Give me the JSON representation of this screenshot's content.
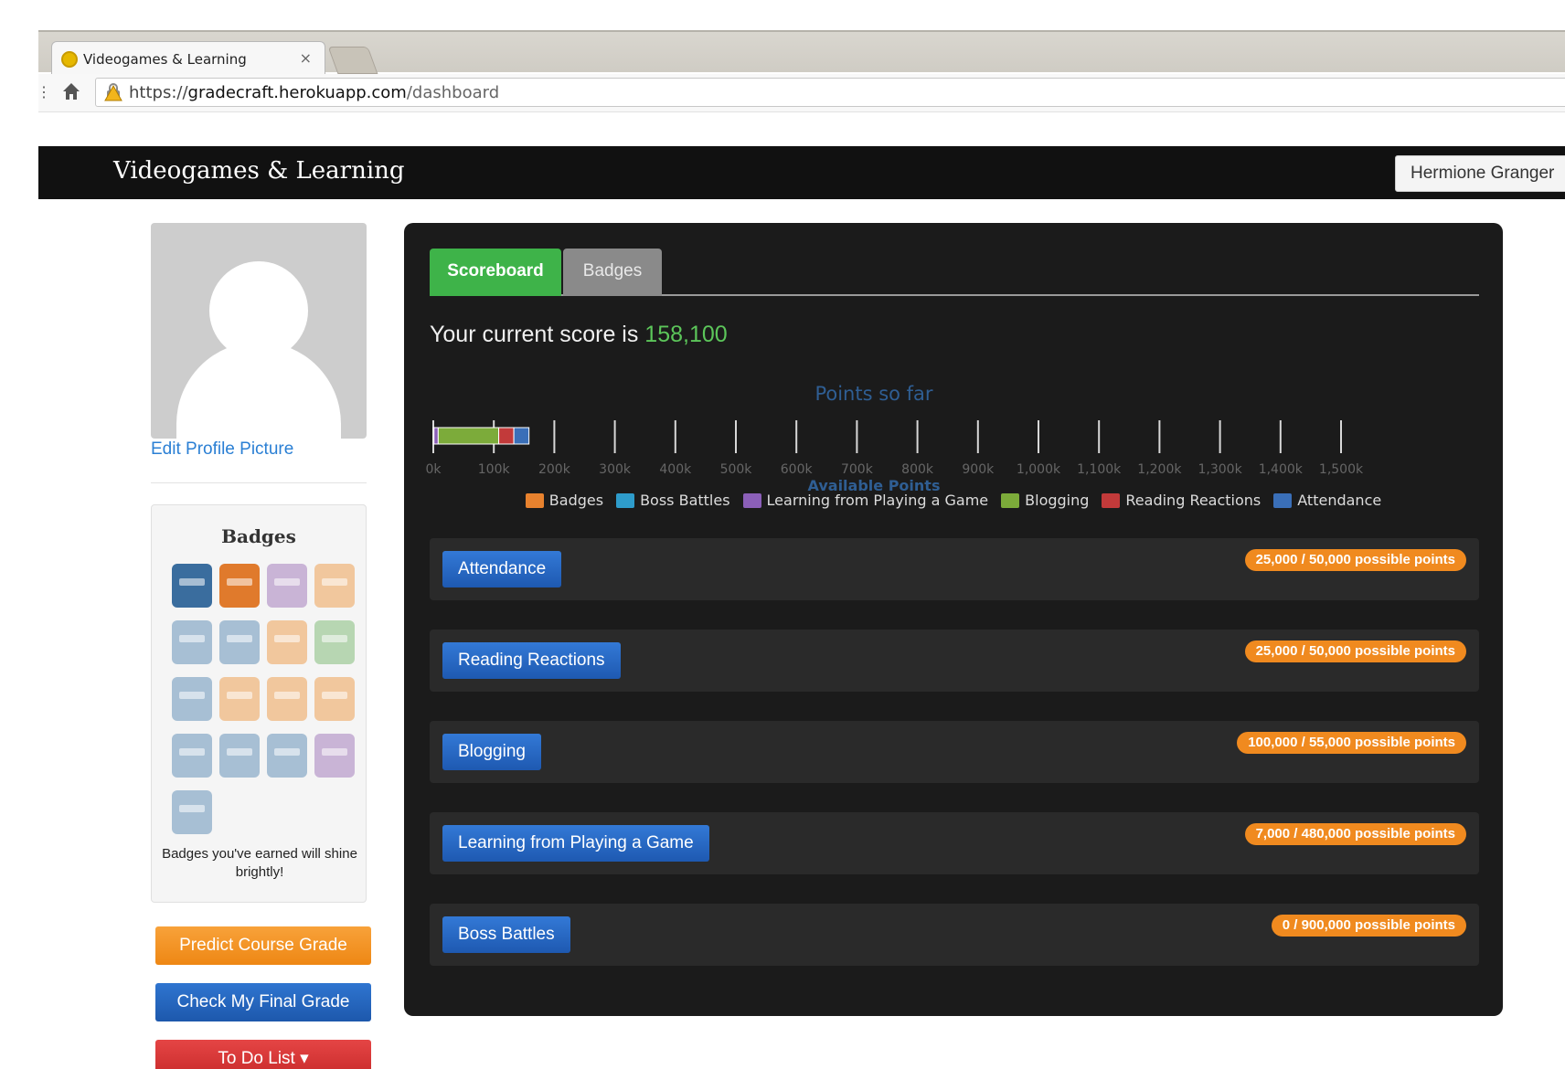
{
  "browser": {
    "tab_title": "Videogames & Learning",
    "tab_close": "×",
    "menu_glyph": "⋮",
    "url_scheme": "https://",
    "url_host": "gradecraft.herokuapp.com",
    "url_path": "/dashboard"
  },
  "navbar": {
    "brand": "Videogames & Learning",
    "user": "Hermione Granger"
  },
  "sidebar": {
    "edit_profile": "Edit Profile Picture",
    "badges_title": "Badges",
    "badges_note": "Badges you've earned will shine brightly!",
    "badges": [
      {
        "icon": "robot-badge-icon",
        "earned": true,
        "tone": "blue"
      },
      {
        "icon": "pirate-badge-icon",
        "earned": true,
        "tone": "orange"
      },
      {
        "icon": "castle-badge-icon",
        "earned": false,
        "tone": "faded-purple"
      },
      {
        "icon": "helmet-badge-icon",
        "earned": false,
        "tone": "faded-orange"
      },
      {
        "icon": "knight-badge-icon",
        "earned": false,
        "tone": "faded-blue"
      },
      {
        "icon": "robot-badge-icon",
        "earned": false,
        "tone": "faded-blue"
      },
      {
        "icon": "pirate-badge-icon",
        "earned": false,
        "tone": "faded-orange"
      },
      {
        "icon": "picture-badge-icon",
        "earned": false,
        "tone": "faded-green"
      },
      {
        "icon": "robot-badge-icon",
        "earned": false,
        "tone": "faded-blue"
      },
      {
        "icon": "chest-badge-icon",
        "earned": false,
        "tone": "faded-orange"
      },
      {
        "icon": "scroll-badge-icon",
        "earned": false,
        "tone": "faded-orange"
      },
      {
        "icon": "pirate-badge-icon",
        "earned": false,
        "tone": "faded-orange"
      },
      {
        "icon": "robot-badge-icon",
        "earned": false,
        "tone": "faded-blue"
      },
      {
        "icon": "knight-badge-icon",
        "earned": false,
        "tone": "faded-blue"
      },
      {
        "icon": "helmet-badge-icon",
        "earned": false,
        "tone": "faded-blue"
      },
      {
        "icon": "blocks-badge-icon",
        "earned": false,
        "tone": "faded-purple"
      },
      {
        "icon": "robot-badge-icon",
        "earned": false,
        "tone": "faded-blue"
      }
    ],
    "predict_button": "Predict Course Grade",
    "final_grade_button": "Check My Final Grade",
    "todo_button": "To Do List ▾"
  },
  "main": {
    "tabs": [
      {
        "label": "Scoreboard",
        "active": true
      },
      {
        "label": "Badges",
        "active": false
      }
    ],
    "score_prefix": "Your current score is ",
    "score_value": "158,100",
    "categories": [
      {
        "button": "Attendance",
        "points": "25,000 / 50,000 possible points"
      },
      {
        "button": "Reading Reactions",
        "points": "25,000 / 50,000 possible points"
      },
      {
        "button": "Blogging",
        "points": "100,000 / 55,000 possible points"
      },
      {
        "button": "Learning from Playing a Game",
        "points": "7,000 / 480,000 possible points"
      },
      {
        "button": "Boss Battles",
        "points": "0 / 900,000 possible points"
      }
    ]
  },
  "chart_data": {
    "type": "bar",
    "orientation": "horizontal-stacked",
    "title": "Points so far",
    "xlabel": "Available Points",
    "xlim": [
      0,
      1500000
    ],
    "tick_labels": [
      "0k",
      "100k",
      "200k",
      "300k",
      "400k",
      "500k",
      "600k",
      "700k",
      "800k",
      "900k",
      "1,000k",
      "1,100k",
      "1,200k",
      "1,300k",
      "1,400k",
      "1,500k"
    ],
    "series": [
      {
        "name": "Badges",
        "value": 1100,
        "color": "#e8822e"
      },
      {
        "name": "Boss Battles",
        "value": 0,
        "color": "#2e9ccb"
      },
      {
        "name": "Learning from Playing a Game",
        "value": 7000,
        "color": "#8b5fb8"
      },
      {
        "name": "Blogging",
        "value": 100000,
        "color": "#7cab3a"
      },
      {
        "name": "Reading Reactions",
        "value": 25000,
        "color": "#c23a3a"
      },
      {
        "name": "Attendance",
        "value": 25000,
        "color": "#3a6fb8"
      }
    ],
    "stack_order": [
      "Badges",
      "Learning from Playing a Game",
      "Blogging",
      "Reading Reactions",
      "Attendance",
      "Boss Battles"
    ],
    "legend_position": "bottom"
  }
}
